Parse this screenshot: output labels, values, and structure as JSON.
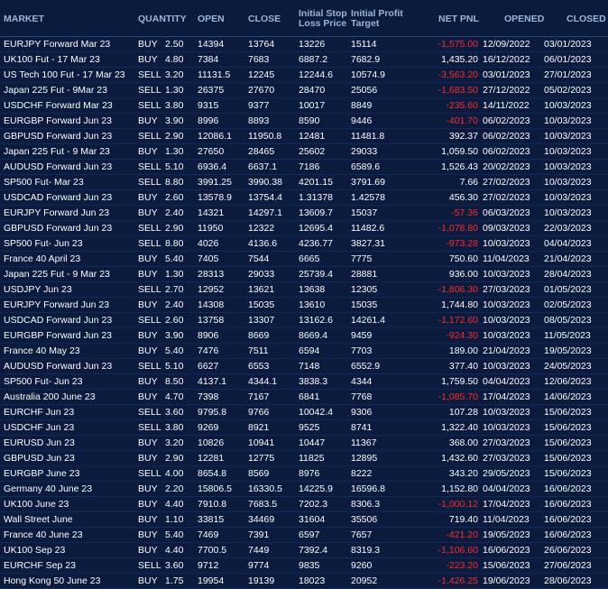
{
  "headers": {
    "market": "MARKET",
    "quantity": "QUANTITY",
    "open": "OPEN",
    "close": "CLOSE",
    "stop_loss": "Initial Stop Loss Price",
    "profit_target": "Initial Profit Target",
    "net_pnl": "NET PNL",
    "opened": "OPENED",
    "closed": "CLOSED"
  },
  "colors": {
    "background": "#0a1b3d",
    "header_text": "#9db4da",
    "negative": "#ff2b2b",
    "text": "#ffffff"
  },
  "rows": [
    {
      "market": "EURJPY Forward Mar 23",
      "side": "BUY",
      "qty": "2.50",
      "open": "14394",
      "close": "13764",
      "stop": "13226",
      "target": "15114",
      "pnl": "-1,575.00",
      "opened": "12/09/2022",
      "closed": "03/01/2023"
    },
    {
      "market": "UK100 Fut - 17 Mar 23",
      "side": "BUY",
      "qty": "4.80",
      "open": "7384",
      "close": "7683",
      "stop": "6887.2",
      "target": "7682.9",
      "pnl": "1,435.20",
      "opened": "16/12/2022",
      "closed": "06/01/2023"
    },
    {
      "market": "US Tech 100 Fut - 17 Mar 23",
      "side": "SELL",
      "qty": "3.20",
      "open": "11131.5",
      "close": "12245",
      "stop": "12244.6",
      "target": "10574.9",
      "pnl": "-3,563.20",
      "opened": "03/01/2023",
      "closed": "27/01/2023"
    },
    {
      "market": "Japan 225 Fut - 9Mar 23",
      "side": "SELL",
      "qty": "1.30",
      "open": "26375",
      "close": "27670",
      "stop": "28470",
      "target": "25056",
      "pnl": "-1,683.50",
      "opened": "27/12/2022",
      "closed": "05/02/2023"
    },
    {
      "market": "USDCHF Forward Mar 23",
      "side": "SELL",
      "qty": "3.80",
      "open": "9315",
      "close": "9377",
      "stop": "10017",
      "target": "8849",
      "pnl": "-235.60",
      "opened": "14/11/2022",
      "closed": "10/03/2023"
    },
    {
      "market": "EURGBP Forward Jun 23",
      "side": "BUY",
      "qty": "3.90",
      "open": "8996",
      "close": "8893",
      "stop": "8590",
      "target": "9446",
      "pnl": "-401.70",
      "opened": "06/02/2023",
      "closed": "10/03/2023"
    },
    {
      "market": "GBPUSD Forward Jun 23",
      "side": "SELL",
      "qty": "2.90",
      "open": "12086.1",
      "close": "11950.8",
      "stop": "12481",
      "target": "11481.8",
      "pnl": "392.37",
      "opened": "06/02/2023",
      "closed": "10/03/2023"
    },
    {
      "market": "Japan 225 Fut - 9 Mar 23",
      "side": "BUY",
      "qty": "1.30",
      "open": "27650",
      "close": "28465",
      "stop": "25602",
      "target": "29033",
      "pnl": "1,059.50",
      "opened": "06/02/2023",
      "closed": "10/03/2023"
    },
    {
      "market": "AUDUSD Forward Jun 23",
      "side": "SELL",
      "qty": "5.10",
      "open": "6936.4",
      "close": "6637.1",
      "stop": "7186",
      "target": "6589.6",
      "pnl": "1,526.43",
      "opened": "20/02/2023",
      "closed": "10/03/2023"
    },
    {
      "market": "SP500 Fut- Mar 23",
      "side": "SELL",
      "qty": "8.80",
      "open": "3991.25",
      "close": "3990.38",
      "stop": "4201.15",
      "target": "3791.69",
      "pnl": "7.66",
      "opened": "27/02/2023",
      "closed": "10/03/2023"
    },
    {
      "market": "USDCAD Forward Jun 23",
      "side": "BUY",
      "qty": "2.60",
      "open": "13578.9",
      "close": "13754.4",
      "stop": "1.31378",
      "target": "1.42578",
      "pnl": "456.30",
      "opened": "27/02/2023",
      "closed": "10/03/2023"
    },
    {
      "market": "EURJPY Forward Jun 23",
      "side": "BUY",
      "qty": "2.40",
      "open": "14321",
      "close": "14297.1",
      "stop": "13609.7",
      "target": "15037",
      "pnl": "-57.36",
      "opened": "06/03/2023",
      "closed": "10/03/2023"
    },
    {
      "market": "GBPUSD Forward Jun 23",
      "side": "SELL",
      "qty": "2.90",
      "open": "11950",
      "close": "12322",
      "stop": "12695.4",
      "target": "11482.6",
      "pnl": "-1,078.80",
      "opened": "09/03/2023",
      "closed": "22/03/2023"
    },
    {
      "market": "SP500 Fut- Jun 23",
      "side": "SELL",
      "qty": "8.80",
      "open": "4026",
      "close": "4136.6",
      "stop": "4236.77",
      "target": "3827.31",
      "pnl": "-973.28",
      "opened": "10/03/2023",
      "closed": "04/04/2023"
    },
    {
      "market": "France 40 April 23",
      "side": "BUY",
      "qty": "5.40",
      "open": "7405",
      "close": "7544",
      "stop": "6665",
      "target": "7775",
      "pnl": "750.60",
      "opened": "11/04/2023",
      "closed": "21/04/2023"
    },
    {
      "market": "Japan 225 Fut - 9 Mar 23",
      "side": "BUY",
      "qty": "1.30",
      "open": "28313",
      "close": "29033",
      "stop": "25739.4",
      "target": "28881",
      "pnl": "936.00",
      "opened": "10/03/2023",
      "closed": "28/04/2023"
    },
    {
      "market": "USDJPY Jun 23",
      "side": "SELL",
      "qty": "2.70",
      "open": "12952",
      "close": "13621",
      "stop": "13638",
      "target": "12305",
      "pnl": "-1,806.30",
      "opened": "27/03/2023",
      "closed": "01/05/2023"
    },
    {
      "market": "EURJPY Forward Jun 23",
      "side": "BUY",
      "qty": "2.40",
      "open": "14308",
      "close": "15035",
      "stop": "13610",
      "target": "15035",
      "pnl": "1,744.80",
      "opened": "10/03/2023",
      "closed": "02/05/2023"
    },
    {
      "market": "USDCAD Forward Jun 23",
      "side": "SELL",
      "qty": "2.60",
      "open": "13758",
      "close": "13307",
      "stop": "13162.6",
      "target": "14261.4",
      "pnl": "-1,172.60",
      "opened": "10/03/2023",
      "closed": "08/05/2023"
    },
    {
      "market": "EURGBP Forward Jun 23",
      "side": "BUY",
      "qty": "3.90",
      "open": "8906",
      "close": "8669",
      "stop": "8669.4",
      "target": "9459",
      "pnl": "-924.30",
      "opened": "10/03/2023",
      "closed": "11/05/2023"
    },
    {
      "market": "France 40 May 23",
      "side": "BUY",
      "qty": "5.40",
      "open": "7476",
      "close": "7511",
      "stop": "6594",
      "target": "7703",
      "pnl": "189.00",
      "opened": "21/04/2023",
      "closed": "19/05/2023"
    },
    {
      "market": "AUDUSD Forward Jun 23",
      "side": "SELL",
      "qty": "5.10",
      "open": "6627",
      "close": "6553",
      "stop": "7148",
      "target": "6552.9",
      "pnl": "377.40",
      "opened": "10/03/2023",
      "closed": "24/05/2023"
    },
    {
      "market": "SP500 Fut- Jun 23",
      "side": "BUY",
      "qty": "8.50",
      "open": "4137.1",
      "close": "4344.1",
      "stop": "3838.3",
      "target": "4344",
      "pnl": "1,759.50",
      "opened": "04/04/2023",
      "closed": "12/06/2023"
    },
    {
      "market": "Australia 200 June 23",
      "side": "BUY",
      "qty": "4.70",
      "open": "7398",
      "close": "7167",
      "stop": "6841",
      "target": "7768",
      "pnl": "-1,085.70",
      "opened": "17/04/2023",
      "closed": "14/06/2023"
    },
    {
      "market": "EURCHF Jun 23",
      "side": "SELL",
      "qty": "3.60",
      "open": "9795.8",
      "close": "9766",
      "stop": "10042.4",
      "target": "9306",
      "pnl": "107.28",
      "opened": "10/03/2023",
      "closed": "15/06/2023"
    },
    {
      "market": "USDCHF Jun 23",
      "side": "SELL",
      "qty": "3.80",
      "open": "9269",
      "close": "8921",
      "stop": "9525",
      "target": "8741",
      "pnl": "1,322.40",
      "opened": "10/03/2023",
      "closed": "15/06/2023"
    },
    {
      "market": "EURUSD Jun 23",
      "side": "BUY",
      "qty": "3.20",
      "open": "10826",
      "close": "10941",
      "stop": "10447",
      "target": "11367",
      "pnl": "368.00",
      "opened": "27/03/2023",
      "closed": "15/06/2023"
    },
    {
      "market": "GBPUSD Jun 23",
      "side": "BUY",
      "qty": "2.90",
      "open": "12281",
      "close": "12775",
      "stop": "11825",
      "target": "12895",
      "pnl": "1,432.60",
      "opened": "27/03/2023",
      "closed": "15/06/2023"
    },
    {
      "market": "EURGBP June 23",
      "side": "SELL",
      "qty": "4.00",
      "open": "8654.8",
      "close": "8569",
      "stop": "8976",
      "target": "8222",
      "pnl": "343.20",
      "opened": "29/05/2023",
      "closed": "15/06/2023"
    },
    {
      "market": "Germany 40 June 23",
      "side": "BUY",
      "qty": "2.20",
      "open": "15806.5",
      "close": "16330.5",
      "stop": "14225.9",
      "target": "16596.8",
      "pnl": "1,152.80",
      "opened": "04/04/2023",
      "closed": "16/06/2023"
    },
    {
      "market": "UK100 June 23",
      "side": "BUY",
      "qty": "4.40",
      "open": "7910.8",
      "close": "7683.5",
      "stop": "7202.3",
      "target": "8306.3",
      "pnl": "-1,000.12",
      "opened": "17/04/2023",
      "closed": "16/06/2023"
    },
    {
      "market": "Wall Street June",
      "side": "BUY",
      "qty": "1.10",
      "open": "33815",
      "close": "34469",
      "stop": "31604",
      "target": "35506",
      "pnl": "719.40",
      "opened": "11/04/2023",
      "closed": "16/06/2023"
    },
    {
      "market": "France 40 June 23",
      "side": "BUY",
      "qty": "5.40",
      "open": "7469",
      "close": "7391",
      "stop": "6597",
      "target": "7657",
      "pnl": "-421.20",
      "opened": "19/05/2023",
      "closed": "16/06/2023"
    },
    {
      "market": "UK100 Sep 23",
      "side": "BUY",
      "qty": "4.40",
      "open": "7700.5",
      "close": "7449",
      "stop": "7392.4",
      "target": "8319.3",
      "pnl": "-1,106.60",
      "opened": "16/06/2023",
      "closed": "26/06/2023"
    },
    {
      "market": "EURCHF Sep 23",
      "side": "SELL",
      "qty": "3.60",
      "open": "9712",
      "close": "9774",
      "stop": "9835",
      "target": "9260",
      "pnl": "-223.20",
      "opened": "15/06/2023",
      "closed": "27/06/2023"
    },
    {
      "market": "Hong Kong 50 June 23",
      "side": "BUY",
      "qty": "1.75",
      "open": "19954",
      "close": "19139",
      "stop": "18023",
      "target": "20952",
      "pnl": "-1,426.25",
      "opened": "19/06/2023",
      "closed": "28/06/2023"
    }
  ]
}
